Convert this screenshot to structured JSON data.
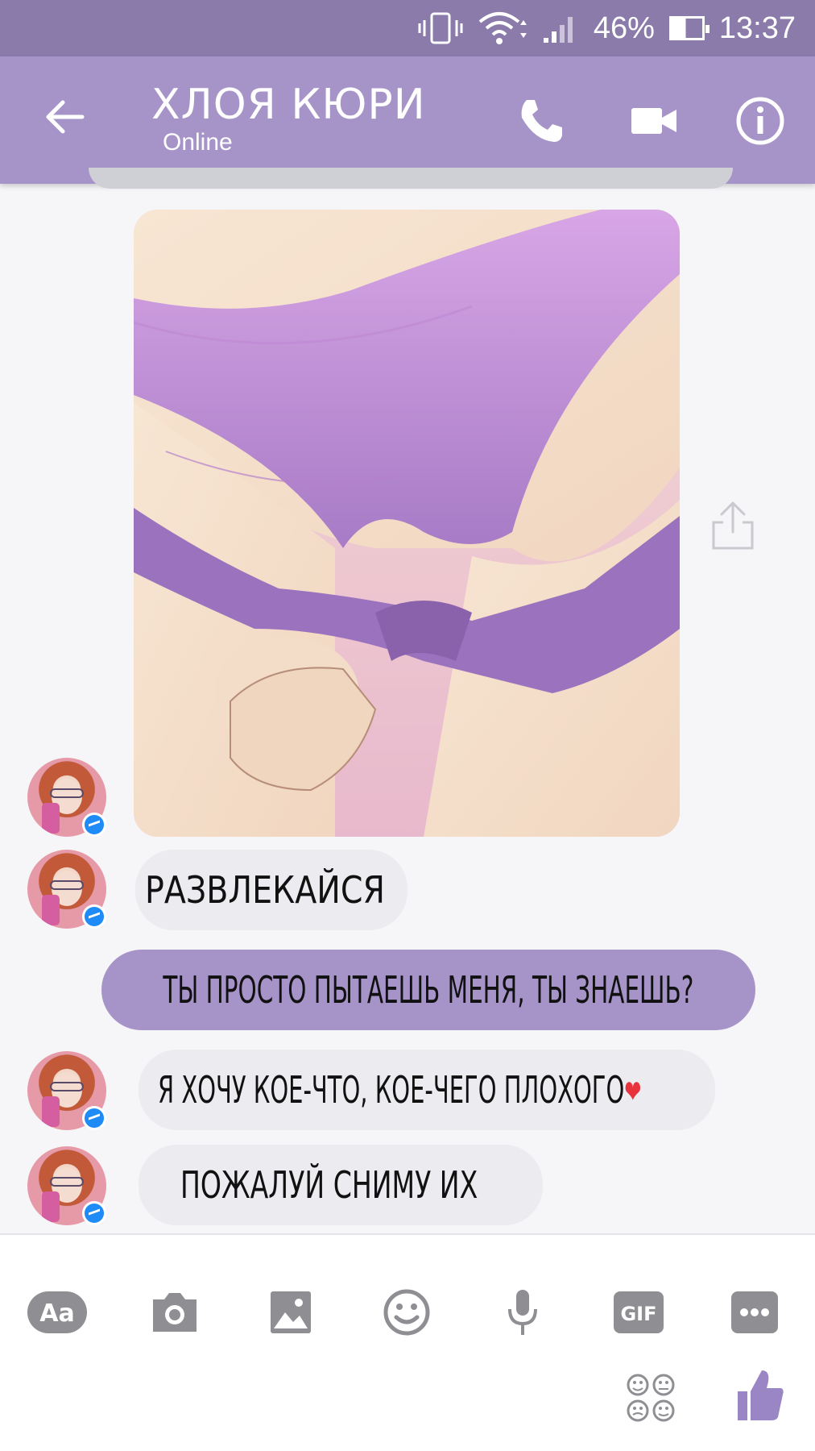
{
  "status_bar": {
    "battery_text": "46%",
    "time": "13:37",
    "icons": [
      "vibrate-icon",
      "wifi-icon",
      "signal-icon",
      "battery-icon"
    ]
  },
  "header": {
    "contact_name": "ХЛОЯ КЮРИ",
    "status": "Online",
    "icons": [
      "back-arrow-icon",
      "phone-icon",
      "video-call-icon",
      "info-icon"
    ]
  },
  "messages": [
    {
      "type": "image",
      "from": "contact",
      "description_icon": "image-message"
    },
    {
      "type": "text",
      "from": "contact",
      "text": "РАЗВЛЕКАЙСЯ"
    },
    {
      "type": "text",
      "from": "me",
      "text": "ТЫ ПРОСТО ПЫТАЕШЬ МЕНЯ, ТЫ ЗНАЕШЬ?"
    },
    {
      "type": "text",
      "from": "contact",
      "text": "Я ХОЧУ КОЕ-ЧТО, КОЕ-ЧЕГО ПЛОХОГО",
      "emoji": "❤"
    },
    {
      "type": "text",
      "from": "contact",
      "text": "ПОЖАЛУЙ СНИМУ ИХ"
    }
  ],
  "composer": {
    "text_button": "Aa",
    "gif_button": "GIF",
    "icons": [
      "text-icon",
      "camera-icon",
      "gallery-icon",
      "emoji-icon",
      "microphone-icon",
      "gif-icon",
      "more-icon",
      "stickers-icon",
      "like-icon"
    ]
  },
  "colors": {
    "status_bar": "#8a7bab",
    "header": "#a694c9",
    "outgoing_bubble": "#a694c9",
    "incoming_bubble": "#ececf0",
    "icon_gray": "#8e8e93",
    "like_purple": "#9a86c4"
  }
}
